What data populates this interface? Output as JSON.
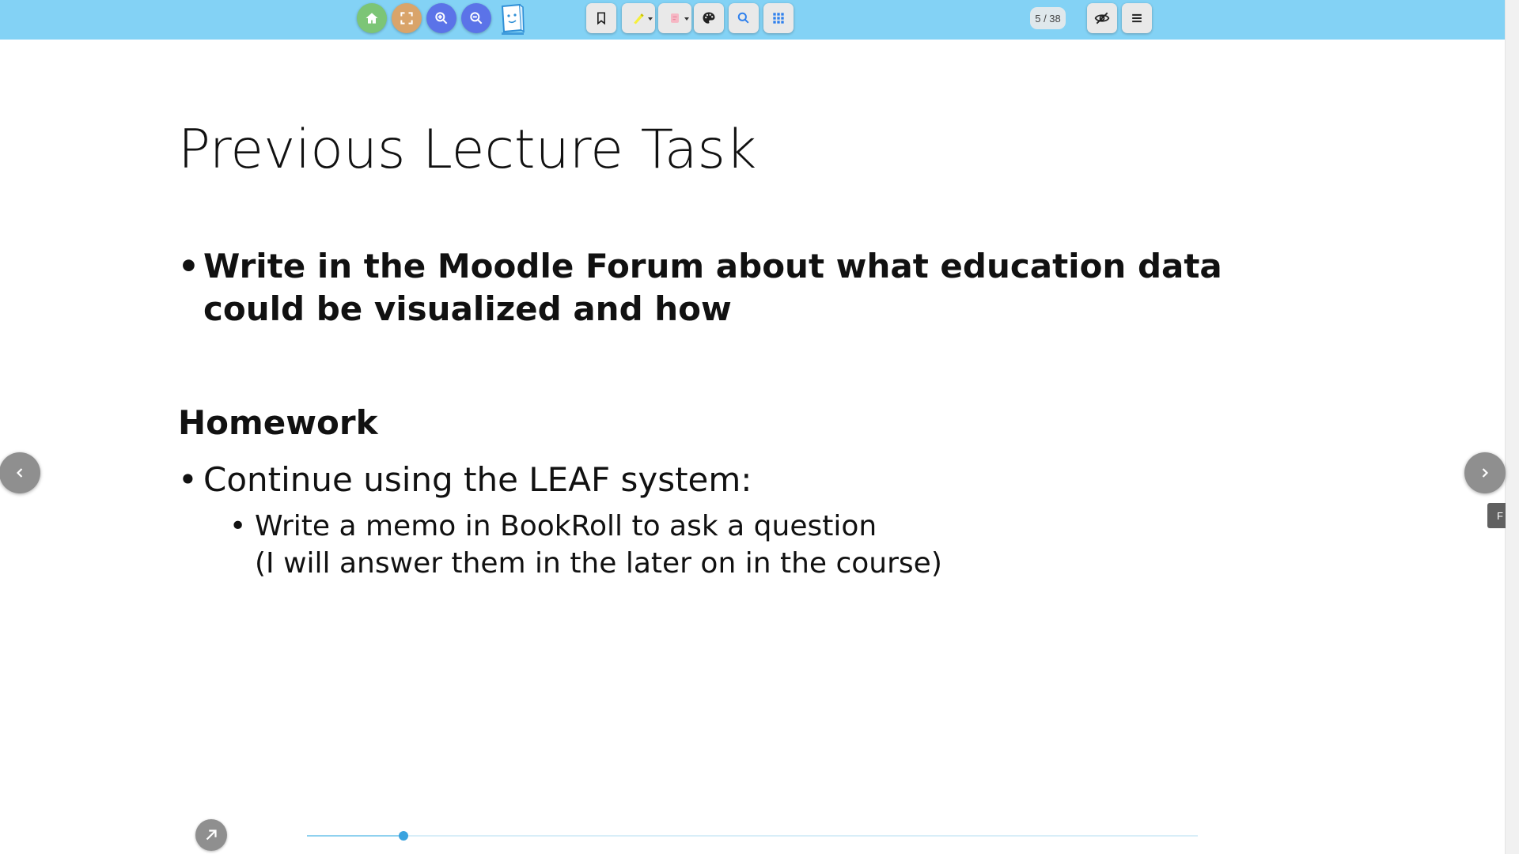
{
  "toolbar": {
    "colors": {
      "background": "#83d2f5",
      "home": "#7cc576",
      "fullscreen": "#d9a46a",
      "zoom": "#5b73e8"
    },
    "buttons": [
      {
        "name": "home-button",
        "icon": "home-icon"
      },
      {
        "name": "fullscreen-button",
        "icon": "fullscreen-icon"
      },
      {
        "name": "zoom-in-button",
        "icon": "zoom-in-icon"
      },
      {
        "name": "zoom-out-button",
        "icon": "zoom-out-icon"
      },
      {
        "name": "bookmark-button",
        "icon": "bookmark-icon"
      },
      {
        "name": "marker-button",
        "icon": "marker-icon"
      },
      {
        "name": "memo-button",
        "icon": "memo-icon"
      },
      {
        "name": "palette-button",
        "icon": "palette-icon"
      },
      {
        "name": "search-button",
        "icon": "search-icon"
      },
      {
        "name": "grid-view-button",
        "icon": "grid-icon"
      },
      {
        "name": "hide-toolbar-button",
        "icon": "eye-off-icon"
      },
      {
        "name": "menu-button",
        "icon": "hamburger-icon"
      }
    ],
    "page_indicator": "5 / 38"
  },
  "slide": {
    "title": "Previous Lecture Task",
    "bullet1": "Write in the Moodle Forum about what education data could be visualized and how",
    "homework_heading": "Homework",
    "bullet2": "Continue using the LEAF system:",
    "sub_bullet_line1": "Write a memo in BookRoll to ask a question",
    "sub_bullet_line2": "(I will answer them in the later on in the course)",
    "bullet_char": "•"
  },
  "side_tab": {
    "label": "F"
  },
  "progress": {
    "current_page": 5,
    "total_pages": 38,
    "fraction": 0.108
  }
}
